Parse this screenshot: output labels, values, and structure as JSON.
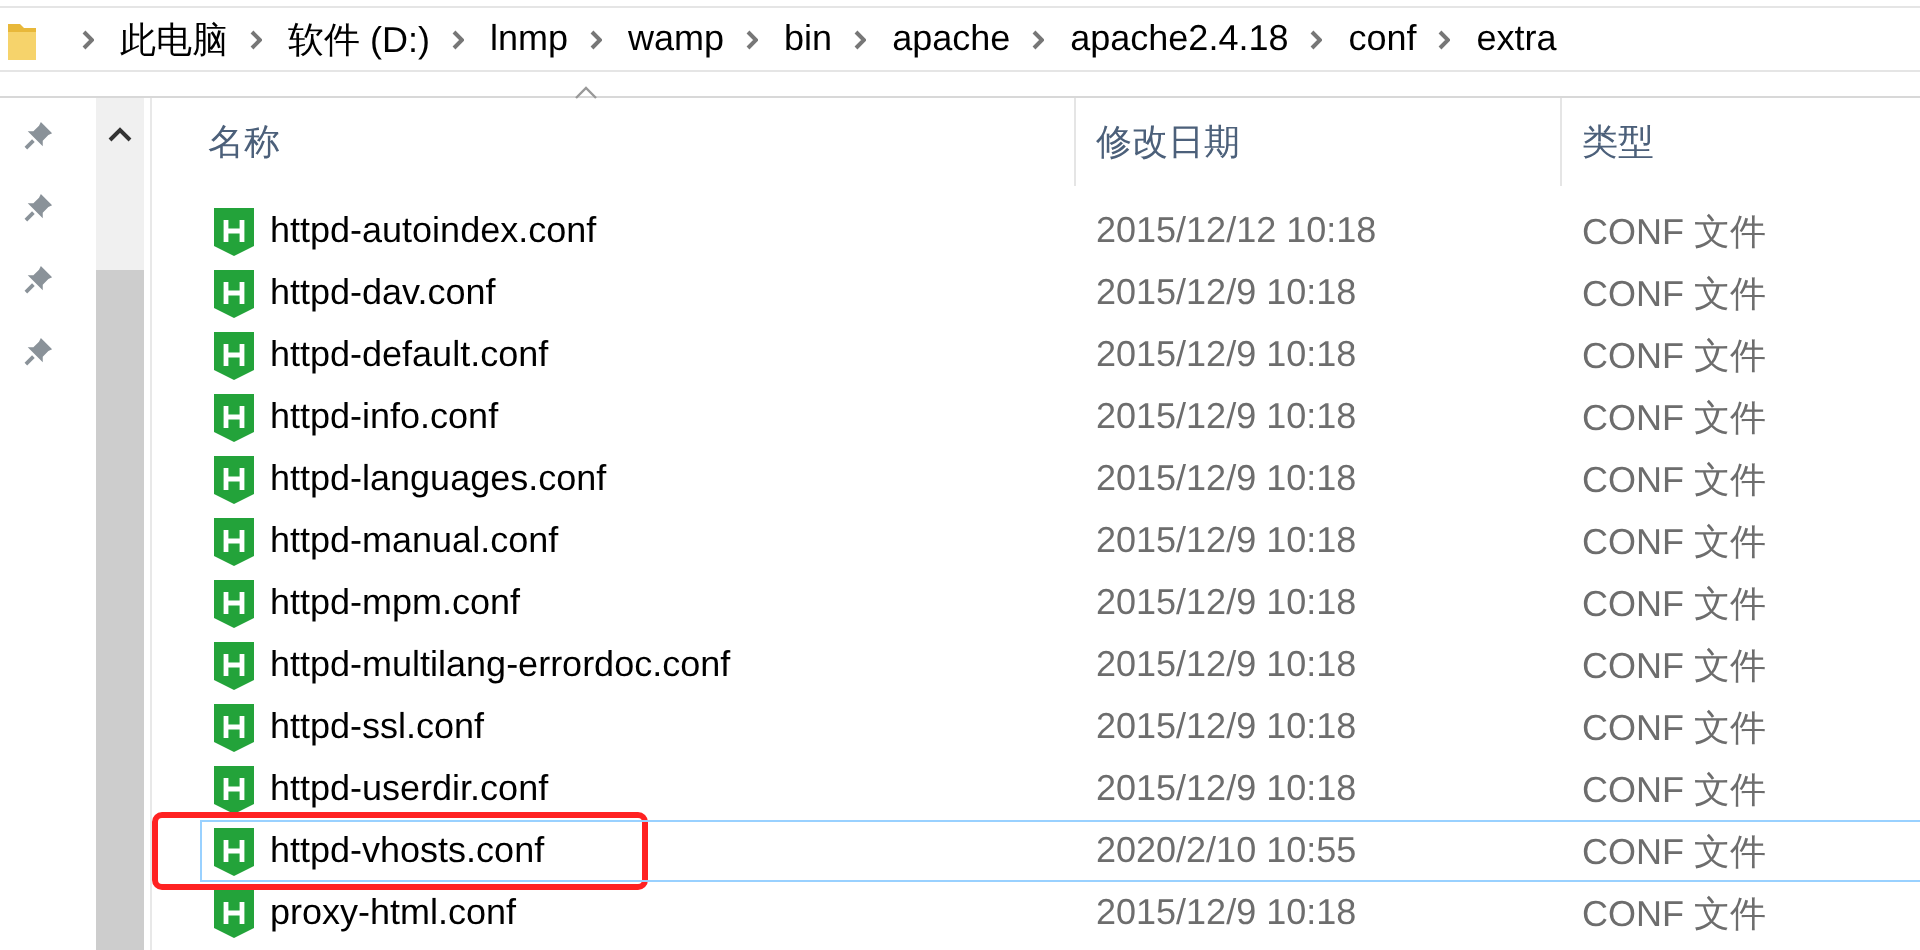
{
  "breadcrumb": [
    "此电脑",
    "软件 (D:)",
    "lnmp",
    "wamp",
    "bin",
    "apache",
    "apache2.4.18",
    "conf",
    "extra"
  ],
  "quick_access": [
    {
      "pinned": true
    },
    {
      "pinned": true
    },
    {
      "pinned": true
    },
    {
      "pinned": true
    }
  ],
  "columns": [
    {
      "label": "名称",
      "sorted": true
    },
    {
      "label": "修改日期",
      "sorted": false
    },
    {
      "label": "类型",
      "sorted": false
    }
  ],
  "files": [
    {
      "name": "httpd-autoindex.conf",
      "modified": "2015/12/12 10:18",
      "type": "CONF 文件",
      "selected": false,
      "annotated": false
    },
    {
      "name": "httpd-dav.conf",
      "modified": "2015/12/9 10:18",
      "type": "CONF 文件",
      "selected": false,
      "annotated": false
    },
    {
      "name": "httpd-default.conf",
      "modified": "2015/12/9 10:18",
      "type": "CONF 文件",
      "selected": false,
      "annotated": false
    },
    {
      "name": "httpd-info.conf",
      "modified": "2015/12/9 10:18",
      "type": "CONF 文件",
      "selected": false,
      "annotated": false
    },
    {
      "name": "httpd-languages.conf",
      "modified": "2015/12/9 10:18",
      "type": "CONF 文件",
      "selected": false,
      "annotated": false
    },
    {
      "name": "httpd-manual.conf",
      "modified": "2015/12/9 10:18",
      "type": "CONF 文件",
      "selected": false,
      "annotated": false
    },
    {
      "name": "httpd-mpm.conf",
      "modified": "2015/12/9 10:18",
      "type": "CONF 文件",
      "selected": false,
      "annotated": false
    },
    {
      "name": "httpd-multilang-errordoc.conf",
      "modified": "2015/12/9 10:18",
      "type": "CONF 文件",
      "selected": false,
      "annotated": false
    },
    {
      "name": "httpd-ssl.conf",
      "modified": "2015/12/9 10:18",
      "type": "CONF 文件",
      "selected": false,
      "annotated": false
    },
    {
      "name": "httpd-userdir.conf",
      "modified": "2015/12/9 10:18",
      "type": "CONF 文件",
      "selected": false,
      "annotated": false
    },
    {
      "name": "httpd-vhosts.conf",
      "modified": "2020/2/10 10:55",
      "type": "CONF 文件",
      "selected": true,
      "annotated": true
    },
    {
      "name": "proxy-html.conf",
      "modified": "2015/12/9 10:18",
      "type": "CONF 文件",
      "selected": false,
      "annotated": false
    }
  ]
}
